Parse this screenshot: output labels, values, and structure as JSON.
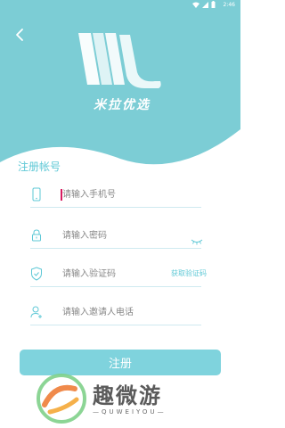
{
  "status_bar": {
    "time": "2:46"
  },
  "header": {
    "brand": "米拉优选",
    "back_icon": "back-arrow"
  },
  "form": {
    "section_title": "注册帐号",
    "phone": {
      "placeholder": "请输入手机号"
    },
    "password": {
      "placeholder": "请输入密码"
    },
    "code": {
      "placeholder": "请输入验证码",
      "get_code_label": "获取验证码"
    },
    "invite": {
      "placeholder": "请输入邀请人电话"
    },
    "submit_label": "注册"
  },
  "watermark": {
    "text": "趣微游",
    "sub": "—QUWEIYOU—"
  },
  "colors": {
    "accent": "#7fd3dd",
    "hero": "#7ccdd5",
    "link": "#5ec8d6"
  }
}
